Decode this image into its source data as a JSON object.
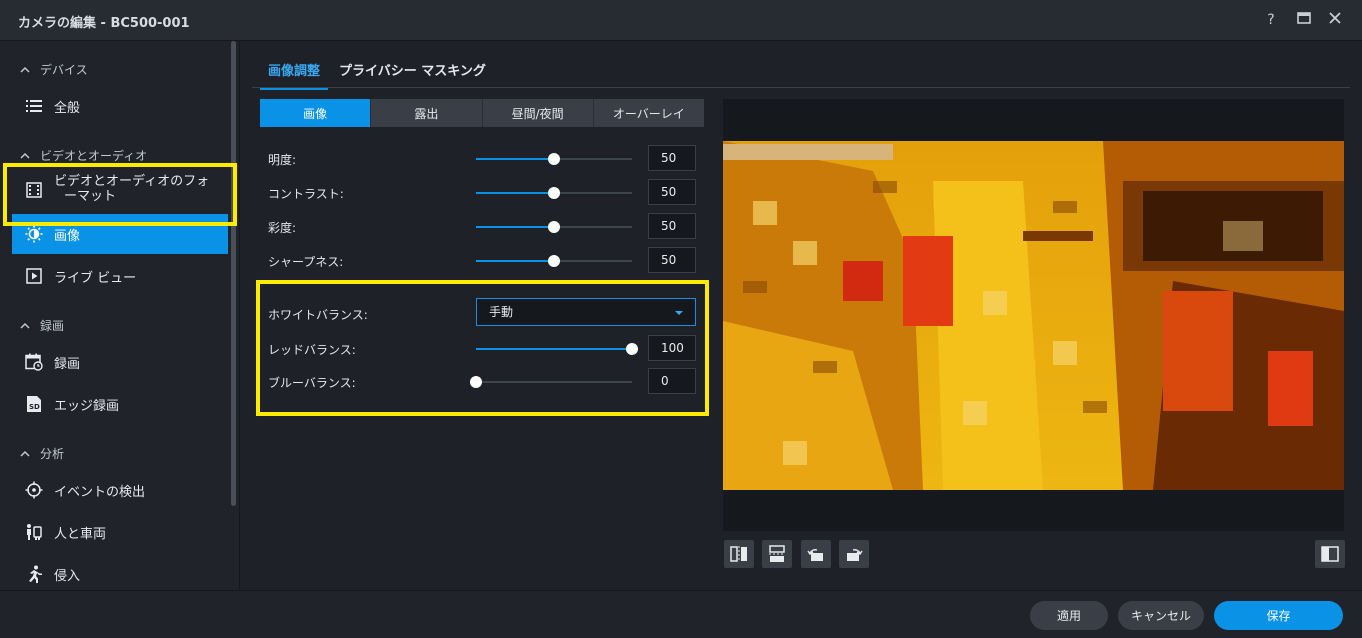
{
  "window": {
    "title": "カメラの編集 - BC500-001",
    "help": "?",
    "maximize": "□",
    "close": "✕"
  },
  "sidebar": {
    "sections": [
      {
        "label": "デバイス",
        "items": [
          {
            "label": "全般",
            "icon": "list-icon"
          }
        ]
      },
      {
        "label": "ビデオとオーディオ",
        "items": [
          {
            "label": "ビデオとオーディオのフォ",
            "label2": "ーマット",
            "icon": "film-icon"
          },
          {
            "label": "画像",
            "icon": "brightness-icon",
            "active": true
          },
          {
            "label": "ライブ ビュー",
            "icon": "play-icon"
          }
        ]
      },
      {
        "label": "録画",
        "items": [
          {
            "label": "録画",
            "icon": "calendar-clock-icon"
          },
          {
            "label": "エッジ録画",
            "icon": "sd-card-icon"
          }
        ]
      },
      {
        "label": "分析",
        "items": [
          {
            "label": "イベントの検出",
            "icon": "crosshair-icon"
          },
          {
            "label": "人と車両",
            "icon": "person-vehicle-icon"
          },
          {
            "label": "侵入",
            "icon": "running-person-icon"
          }
        ]
      }
    ]
  },
  "tabs": [
    {
      "label": "画像調整",
      "active": true
    },
    {
      "label": "プライバシー マスキング"
    }
  ],
  "subtabs": [
    {
      "label": "画像",
      "active": true
    },
    {
      "label": "露出"
    },
    {
      "label": "昼間/夜間"
    },
    {
      "label": "オーバーレイ"
    }
  ],
  "adjust": {
    "brightness": {
      "label": "明度:",
      "value": "50",
      "level": 0.5
    },
    "contrast": {
      "label": "コントラスト:",
      "value": "50",
      "level": 0.5
    },
    "saturation": {
      "label": "彩度:",
      "value": "50",
      "level": 0.5
    },
    "sharpness": {
      "label": "シャープネス:",
      "value": "50",
      "level": 0.5
    },
    "white_balance": {
      "label": "ホワイトバランス:",
      "value": "手動"
    },
    "red_balance": {
      "label": "レッドバランス:",
      "value": "100",
      "level": 1.0
    },
    "blue_balance": {
      "label": "ブルーバランス:",
      "value": "0",
      "level": 0.0
    }
  },
  "footer": {
    "apply": "適用",
    "cancel": "キャンセル",
    "save": "保存"
  },
  "colors": {
    "accent": "#0a93e6",
    "highlight": "#ffeb00"
  }
}
